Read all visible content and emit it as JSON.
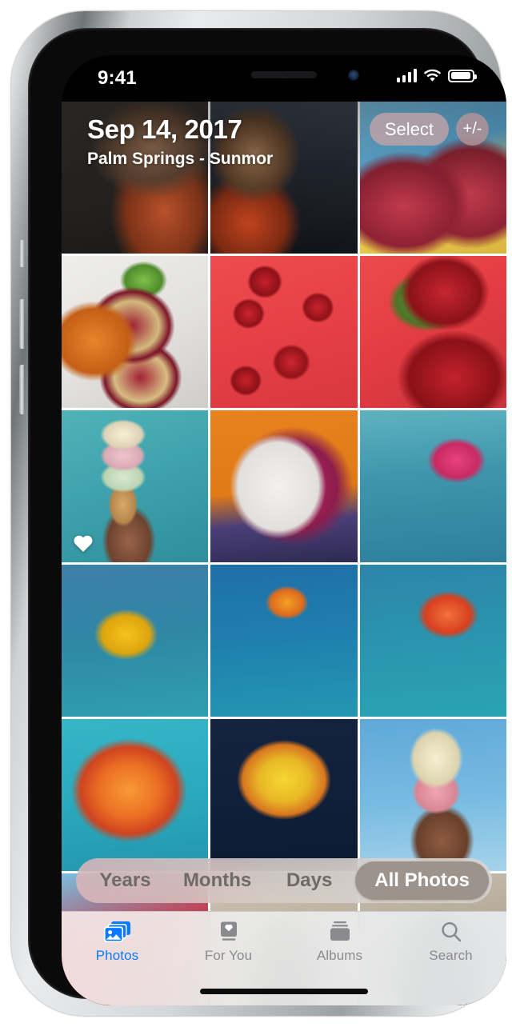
{
  "device": {
    "status_bar": {
      "time": "9:41",
      "signal_icon": "cellular-signal-icon",
      "signal_bars": 4,
      "wifi_icon": "wifi-icon",
      "battery_icon": "battery-icon",
      "battery_level_pct": 85
    },
    "notch": {
      "speaker_icon": "speaker-grille-icon",
      "camera_icon": "front-camera-icon"
    },
    "home_indicator": "home-indicator"
  },
  "header": {
    "title": "Sep 14, 2017",
    "subtitle": "Palm Springs - Sunmor",
    "select_label": "Select",
    "zoom_label": "+/-",
    "zoom_icon": "plus-minus-icon"
  },
  "grid": {
    "columns": 3,
    "photos": [
      {
        "name": "photo-portrait-curly-hair",
        "class": "p-portrait-a",
        "favorite": false
      },
      {
        "name": "photo-portrait-profile",
        "class": "p-portrait-b",
        "favorite": false
      },
      {
        "name": "photo-watermelon-slices",
        "class": "p-watermelon",
        "favorite": false
      },
      {
        "name": "photo-pomegranate-citrus",
        "class": "p-pomegranate",
        "favorite": false
      },
      {
        "name": "photo-strawberries-red-bg",
        "class": "p-strawberries-a",
        "favorite": false
      },
      {
        "name": "photo-strawberries-closeup",
        "class": "p-strawberries-b",
        "favorite": false
      },
      {
        "name": "photo-icecream-cone-pool",
        "class": "p-icecream-pool",
        "favorite": true
      },
      {
        "name": "photo-dragonfruit-half",
        "class": "p-dragonfruit",
        "favorite": false
      },
      {
        "name": "photo-pink-gerbera-daisy",
        "class": "p-pinkflower",
        "favorite": false
      },
      {
        "name": "photo-yellow-gerbera-daisy",
        "class": "p-yellowflower",
        "favorite": false
      },
      {
        "name": "photo-orange-rose-stem",
        "class": "p-orangerose-stem",
        "favorite": false
      },
      {
        "name": "photo-red-orange-rose",
        "class": "p-redrose",
        "favorite": false
      },
      {
        "name": "photo-orange-rose-closeup",
        "class": "p-orangerose-big",
        "favorite": false
      },
      {
        "name": "photo-yellow-rose",
        "class": "p-yellowrose",
        "favorite": false
      },
      {
        "name": "photo-icecream-cone-sky",
        "class": "p-icecream-sky",
        "favorite": false
      },
      {
        "name": "photo-watermelon-partial",
        "class": "p-melon-edge",
        "favorite": false
      },
      {
        "name": "photo-braids-back-a",
        "class": "p-braids-a",
        "favorite": false
      },
      {
        "name": "photo-braids-back-b",
        "class": "p-braids-b",
        "favorite": false
      }
    ]
  },
  "segmented_control": {
    "options": [
      "Years",
      "Months",
      "Days",
      "All Photos"
    ],
    "selected": "All Photos",
    "selected_bg": "#9d938d",
    "selected_text_color": "#ffffff",
    "unselected_text_color": "#6e6a67"
  },
  "tab_bar": {
    "active_color": "#0a7aff",
    "inactive_color": "#8a8a8e",
    "tabs": [
      {
        "label": "Photos",
        "icon": "photos-stack-icon",
        "active": true
      },
      {
        "label": "For You",
        "icon": "for-you-heart-card-icon",
        "active": false
      },
      {
        "label": "Albums",
        "icon": "albums-stack-icon",
        "active": false
      },
      {
        "label": "Search",
        "icon": "search-magnifier-icon",
        "active": false
      }
    ]
  }
}
